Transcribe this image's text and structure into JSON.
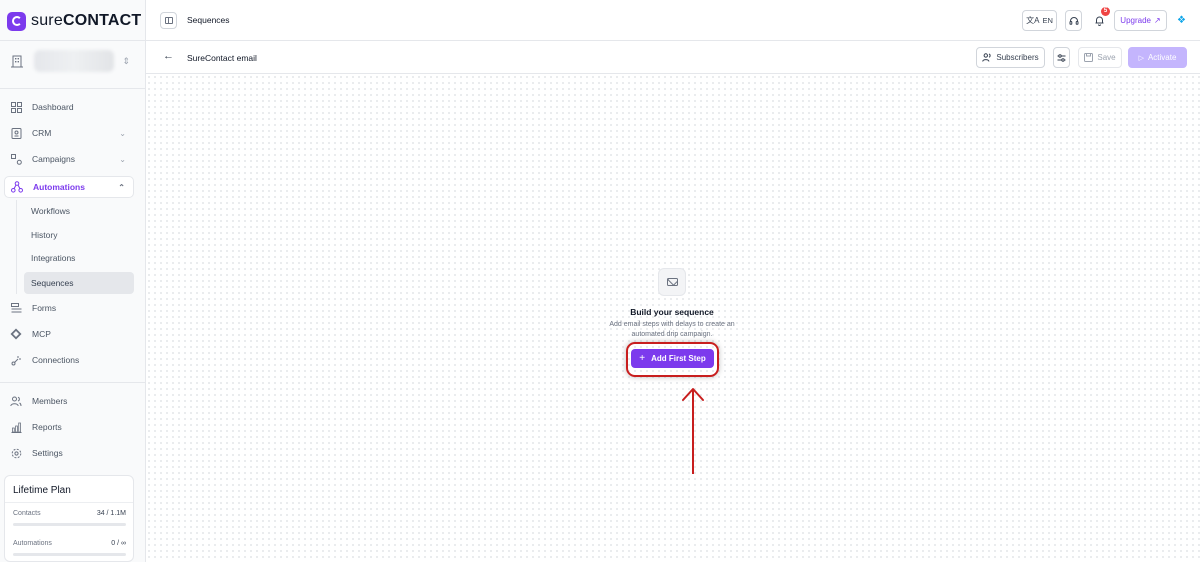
{
  "brand": {
    "name_light": "sure",
    "name_strong": "CONTACT"
  },
  "workspace": {
    "icon": "building-icon"
  },
  "nav": {
    "dashboard": "Dashboard",
    "crm": "CRM",
    "campaigns": "Campaigns",
    "automations": "Automations",
    "automations_sub": [
      "Workflows",
      "History",
      "Integrations",
      "Sequences"
    ],
    "forms": "Forms",
    "mcp": "MCP",
    "connections": "Connections",
    "members": "Members",
    "reports": "Reports",
    "settings": "Settings"
  },
  "plan": {
    "title": "Lifetime Plan",
    "contacts_label": "Contacts",
    "contacts_value": "34 / 1.1M",
    "contacts_progress": 0.0,
    "automations_label": "Automations",
    "automations_value": "0 / ∞",
    "automations_progress": 0.0
  },
  "topbar": {
    "title": "Sequences",
    "lang": "EN",
    "notifications_count": "5",
    "upgrade": "Upgrade"
  },
  "subbar": {
    "sequence_name": "SureContact email",
    "subscribers": "Subscribers",
    "save": "Save",
    "activate": "Activate"
  },
  "empty_state": {
    "title": "Build your sequence",
    "description": "Add email steps with delays to create an automated drip campaign.",
    "button": "Add First Step"
  },
  "colors": {
    "accent": "#7c3aed",
    "activate_disabled": "#c4b5fd",
    "annotation": "#c81e1e",
    "badge": "#ef4444"
  }
}
